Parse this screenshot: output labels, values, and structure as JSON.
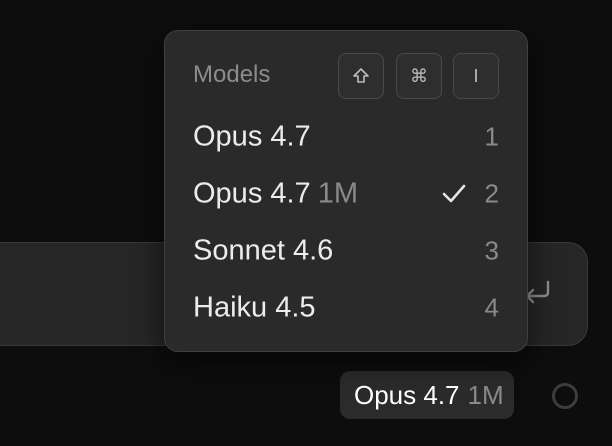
{
  "menu": {
    "title": "Models",
    "shortcut_keys": [
      {
        "icon": "shift-key-icon"
      },
      {
        "icon": "command-key-icon",
        "glyph": "⌘"
      },
      {
        "label": "I"
      }
    ],
    "items": [
      {
        "name": "Opus 4.7",
        "suffix": "",
        "shortcut": "1",
        "selected": false
      },
      {
        "name": "Opus 4.7",
        "suffix": "1M",
        "shortcut": "2",
        "selected": true
      },
      {
        "name": "Sonnet 4.6",
        "suffix": "",
        "shortcut": "3",
        "selected": false
      },
      {
        "name": "Haiku 4.5",
        "suffix": "",
        "shortcut": "4",
        "selected": false
      }
    ]
  },
  "composer": {
    "submit_icon": "enter-return-icon"
  },
  "model_selector": {
    "name": "Opus 4.7",
    "suffix": "1M"
  },
  "status_indicator": {
    "icon": "ring-icon"
  },
  "colors": {
    "background": "#0d0d0d",
    "menu_bg": "#2a2a2a",
    "composer_bg": "#262626",
    "text_primary": "#ececec",
    "text_muted": "#8a8a8a"
  }
}
